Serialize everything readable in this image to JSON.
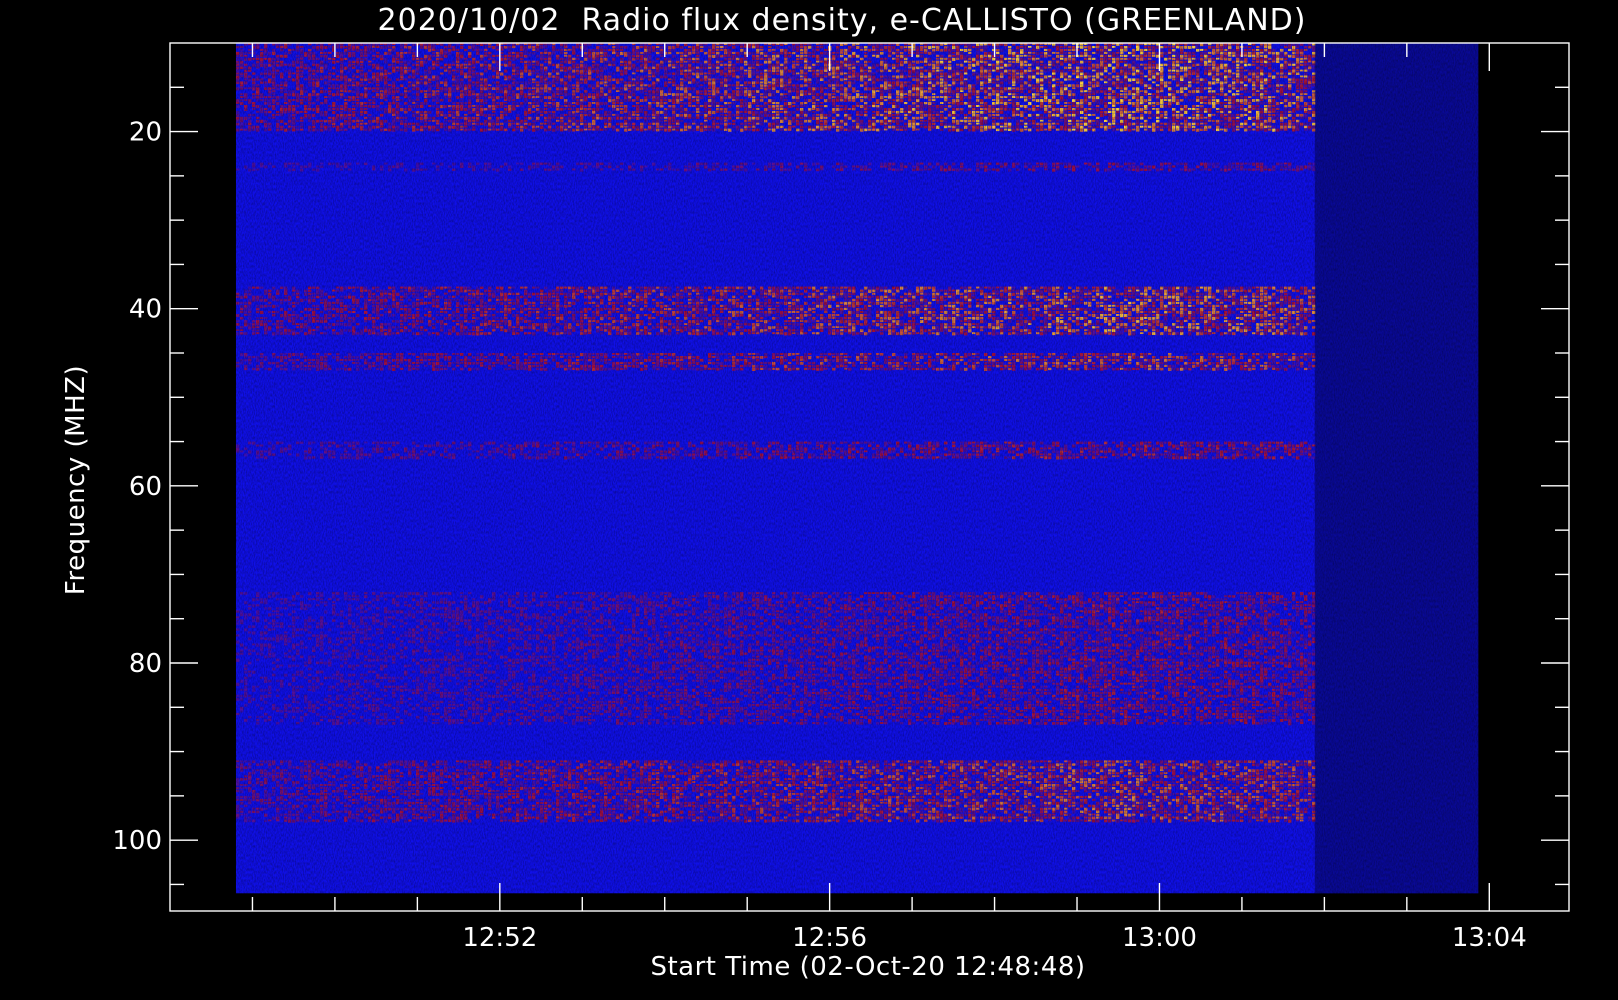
{
  "chart_data": {
    "type": "heatmap",
    "title": "2020/10/02  Radio flux density, e-CALLISTO (GREENLAND)",
    "xlabel": "Start Time (02-Oct-20 12:48:48)",
    "ylabel": "Frequency (MHZ)",
    "x_start": "12:48:48",
    "x_end": "13:03:52",
    "x_data_end_dim": "13:01:53",
    "xlim": [
      "12:48:00",
      "13:04:58"
    ],
    "ylim": [
      108,
      10
    ],
    "y_data_range": [
      10,
      106
    ],
    "x_major_ticks": [
      "12:52",
      "12:56",
      "13:00",
      "13:04"
    ],
    "x_minor_ticks": [
      "12:49",
      "12:50",
      "12:51",
      "12:53",
      "12:54",
      "12:55",
      "12:57",
      "12:58",
      "12:59",
      "13:01",
      "13:02",
      "13:03"
    ],
    "y_major_ticks": [
      20,
      40,
      60,
      80,
      100
    ],
    "y_minor_ticks": [
      15,
      25,
      30,
      35,
      45,
      50,
      55,
      65,
      70,
      75,
      85,
      90,
      95,
      105
    ],
    "y_inverted": true,
    "grid": false,
    "colormap": "blue-red-yellow",
    "colors": {
      "background": "#000000",
      "low": "#1010e8",
      "mid": "#d01010",
      "high": "#ffd040"
    },
    "intense_bands_mhz": [
      {
        "from": 10,
        "to": 20,
        "strength": 0.95
      },
      {
        "from": 23.5,
        "to": 24.5,
        "strength": 0.45
      },
      {
        "from": 37.5,
        "to": 43,
        "strength": 0.85
      },
      {
        "from": 45,
        "to": 47,
        "strength": 0.75
      },
      {
        "from": 55,
        "to": 57,
        "strength": 0.55
      },
      {
        "from": 72,
        "to": 87,
        "strength": 0.5
      },
      {
        "from": 91,
        "to": 98,
        "strength": 0.75
      }
    ],
    "activity_peak_time": "12:59:30"
  }
}
